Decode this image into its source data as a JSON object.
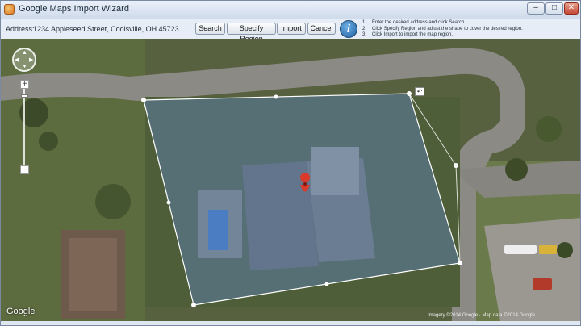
{
  "window": {
    "title": "Google Maps Import Wizard",
    "min_symbol": "–",
    "max_symbol": "□",
    "close_symbol": "✕"
  },
  "toolbar": {
    "address_label": "Address:",
    "address_value": "1234 Appleseed Street, Coolsville, OH 45723",
    "search_label": "Search",
    "specify_label": "Specify Region",
    "import_label": "Import",
    "cancel_label": "Cancel",
    "info_glyph": "i"
  },
  "instructions": [
    {
      "n": "1.",
      "text": "Enter the desired address and click Search"
    },
    {
      "n": "2.",
      "text": "Click Specify Region and adjust the shape to cover the desired region."
    },
    {
      "n": "3.",
      "text": "Click Import to import the map region."
    }
  ],
  "map": {
    "logo": "Google",
    "copyright": "Imagery ©2014 Google · Map data ©2014 Google",
    "undo_glyph": "↶",
    "pan_arrows": {
      "up": "▲",
      "down": "▼",
      "left": "◀",
      "right": "▶"
    },
    "zoom_in": "+",
    "zoom_out": "−",
    "zoom_level_fraction": 0.07,
    "colors": {
      "region_fill": "#5b7fb0",
      "region_stroke": "#ffffff",
      "marker": "#d93a2b"
    }
  }
}
